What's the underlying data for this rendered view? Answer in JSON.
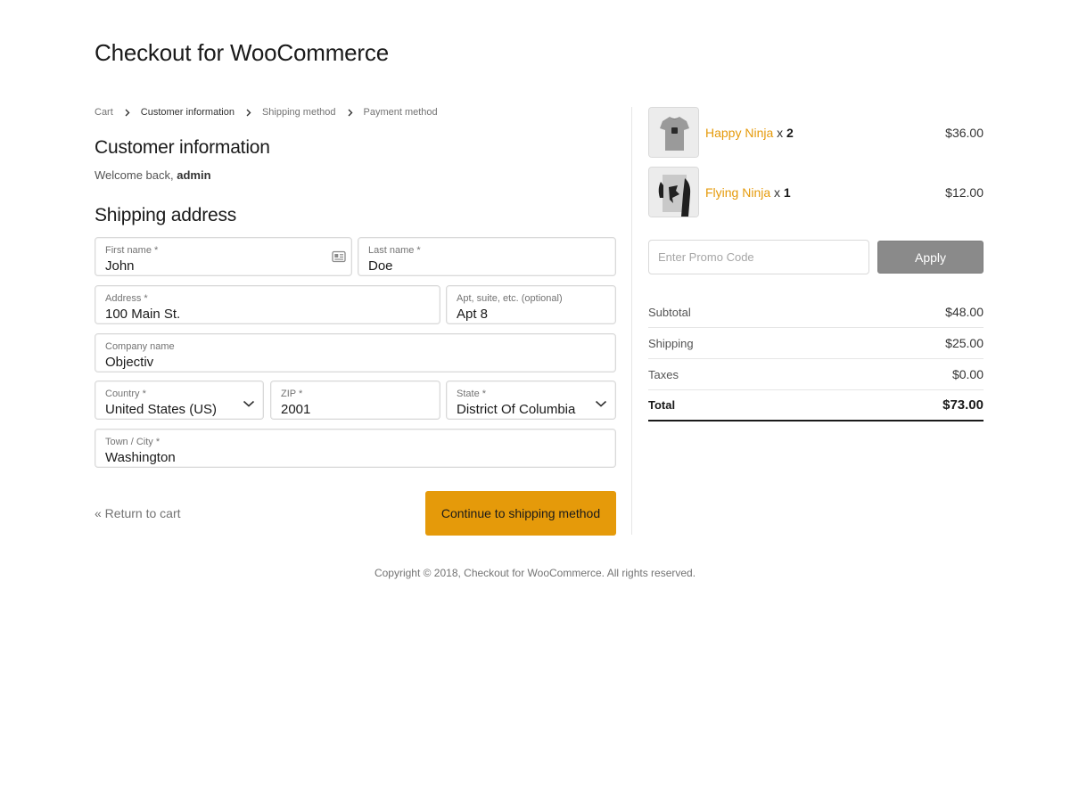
{
  "site": {
    "title": "Checkout for WooCommerce"
  },
  "breadcrumb": [
    {
      "label": "Cart"
    },
    {
      "label": "Customer information"
    },
    {
      "label": "Shipping method"
    },
    {
      "label": "Payment method"
    }
  ],
  "customer": {
    "heading": "Customer information",
    "welcome_prefix": "Welcome back,",
    "username": "admin"
  },
  "shipping": {
    "heading": "Shipping address",
    "first_name": {
      "label": "First name *",
      "value": "John"
    },
    "last_name": {
      "label": "Last name *",
      "value": "Doe"
    },
    "address": {
      "label": "Address *",
      "value": "100 Main St."
    },
    "apt": {
      "label": "Apt, suite, etc. (optional)",
      "value": "Apt 8"
    },
    "company": {
      "label": "Company name",
      "value": "Objectiv"
    },
    "country": {
      "label": "Country *",
      "value": "United States (US)"
    },
    "zip": {
      "label": "ZIP *",
      "value": "2001"
    },
    "state": {
      "label": "State *",
      "value": "District Of Columbia"
    },
    "city": {
      "label": "Town / City *",
      "value": "Washington"
    }
  },
  "actions": {
    "return_label": "« Return to cart",
    "continue_label": "Continue to shipping method"
  },
  "cart": {
    "items": [
      {
        "name": "Happy Ninja",
        "qty_prefix": "x",
        "qty": "2",
        "price": "$36.00"
      },
      {
        "name": "Flying Ninja",
        "qty_prefix": "x",
        "qty": "1",
        "price": "$12.00"
      }
    ],
    "promo_placeholder": "Enter Promo Code",
    "apply_label": "Apply",
    "totals": [
      {
        "label": "Subtotal",
        "value": "$48.00"
      },
      {
        "label": "Shipping",
        "value": "$25.00"
      },
      {
        "label": "Taxes",
        "value": "$0.00"
      },
      {
        "label": "Total",
        "value": "$73.00"
      }
    ]
  },
  "footer": {
    "copyright": "Copyright © 2018, Checkout for WooCommerce.",
    "rights": "All rights reserved."
  },
  "colors": {
    "accent": "#e59a0a",
    "apply_button": "#8a8a8a"
  },
  "icons": {
    "autofill": "contact-card-icon",
    "breadcrumb_separator": "chevron-right-icon",
    "select_arrow": "chevron-down-icon"
  }
}
